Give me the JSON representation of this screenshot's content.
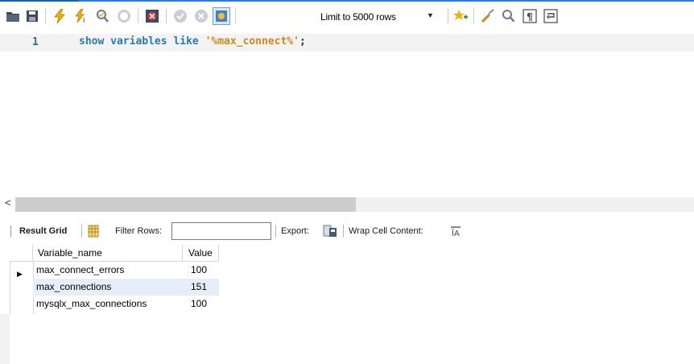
{
  "toolbar": {
    "icons": [
      "open-folder-icon",
      "save-icon",
      "execute-icon",
      "execute-current-icon",
      "explain-icon",
      "stop-icon",
      "toggle-error-icon",
      "commit-icon",
      "rollback-icon",
      "autocommit-icon",
      "bookmark-icon",
      "beautify-icon",
      "find-icon",
      "invisible-chars-icon",
      "wrap-icon"
    ],
    "limit_label": "Limit to 5000 rows"
  },
  "editor": {
    "line_number": "1",
    "code": {
      "kw1": "show",
      "kw2": "variables",
      "kw3": "like",
      "string": "'%max_connect%'",
      "terminator": ";"
    }
  },
  "result_toolbar": {
    "result_grid_label": "Result Grid",
    "filter_rows_label": "Filter Rows:",
    "filter_value": "",
    "export_label": "Export:",
    "wrap_label": "Wrap Cell Content:"
  },
  "grid": {
    "columns": [
      "Variable_name",
      "Value"
    ],
    "rows": [
      {
        "name": "max_connect_errors",
        "value": "100"
      },
      {
        "name": "max_connections",
        "value": "151"
      },
      {
        "name": "mysqlx_max_connections",
        "value": "100"
      }
    ]
  }
}
